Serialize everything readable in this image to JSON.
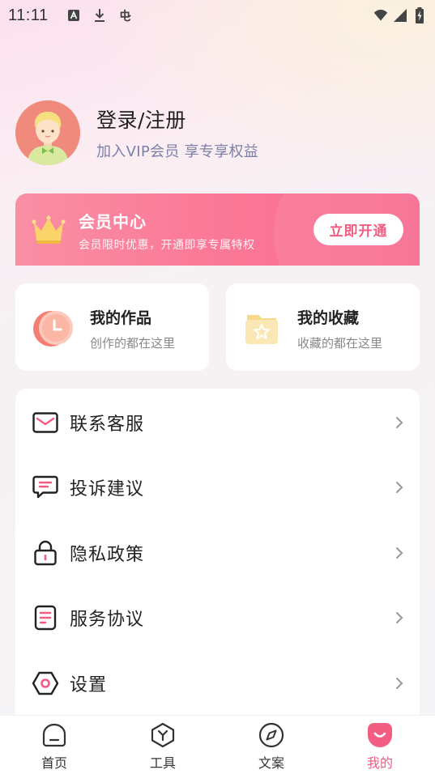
{
  "status_bar": {
    "time": "11:11",
    "icons": [
      "font-icon",
      "download-icon",
      "bug-icon",
      "wifi-icon",
      "signal-icon",
      "battery-charging-icon"
    ]
  },
  "profile": {
    "title": "登录/注册",
    "subtitle": "加入VIP会员 享专享权益"
  },
  "vip": {
    "title": "会员中心",
    "description": "会员限时优惠，开通即享专属特权",
    "button_label": "立即开通"
  },
  "cards": [
    {
      "title": "我的作品",
      "description": "创作的都在这里",
      "icon": "works-clock-icon"
    },
    {
      "title": "我的收藏",
      "description": "收藏的都在这里",
      "icon": "favorites-star-folder-icon"
    }
  ],
  "menu": {
    "items": [
      {
        "label": "联系客服",
        "icon": "mail-icon"
      },
      {
        "label": "投诉建议",
        "icon": "message-icon"
      },
      {
        "label": "隐私政策",
        "icon": "lock-icon"
      },
      {
        "label": "服务协议",
        "icon": "document-icon"
      },
      {
        "label": "设置",
        "icon": "hexagon-settings-icon"
      }
    ]
  },
  "bottom_nav": {
    "items": [
      {
        "label": "首页",
        "icon": "home-icon",
        "active": false
      },
      {
        "label": "工具",
        "icon": "tools-icon",
        "active": false
      },
      {
        "label": "文案",
        "icon": "compass-icon",
        "active": false
      },
      {
        "label": "我的",
        "icon": "mine-smile-icon",
        "active": true
      }
    ]
  },
  "colors": {
    "accent": "#f25d81",
    "vip_gradient_start": "#f98fa5",
    "vip_gradient_end": "#f76b8f",
    "subtitle": "#7a7fa8"
  }
}
